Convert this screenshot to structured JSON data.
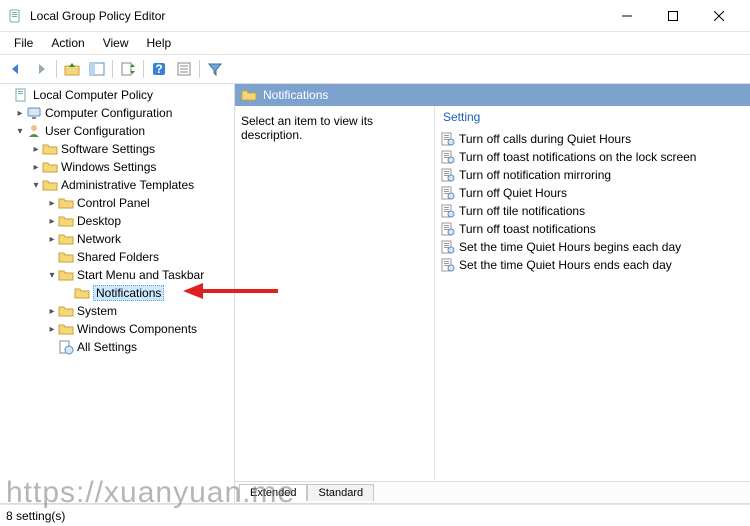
{
  "window": {
    "title": "Local Group Policy Editor"
  },
  "menubar": {
    "items": [
      "File",
      "Action",
      "View",
      "Help"
    ]
  },
  "tree": {
    "root": {
      "label": "Local Computer Policy"
    },
    "computer_cfg": "Computer Configuration",
    "user_cfg": "User Configuration",
    "software_settings": "Software Settings",
    "windows_settings": "Windows Settings",
    "admin_templates": "Administrative Templates",
    "control_panel": "Control Panel",
    "desktop": "Desktop",
    "network": "Network",
    "shared_folders": "Shared Folders",
    "start_taskbar": "Start Menu and Taskbar",
    "notifications": "Notifications",
    "system": "System",
    "windows_components": "Windows Components",
    "all_settings": "All Settings"
  },
  "details": {
    "header": "Notifications",
    "description": "Select an item to view its description.",
    "column_header": "Setting",
    "items": [
      "Turn off calls during Quiet Hours",
      "Turn off toast notifications on the lock screen",
      "Turn off notification mirroring",
      "Turn off Quiet Hours",
      "Turn off tile notifications",
      "Turn off toast notifications",
      "Set the time Quiet Hours begins each day",
      "Set the time Quiet Hours ends each day"
    ]
  },
  "tabs": {
    "extended": "Extended",
    "standard": "Standard"
  },
  "status": {
    "text": "8 setting(s)"
  },
  "watermark": "https://xuanyuan.me"
}
